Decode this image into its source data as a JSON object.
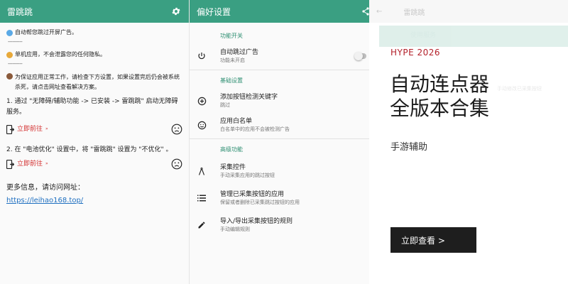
{
  "panel1": {
    "title": "雷跳跳",
    "notes": [
      {
        "text": "自动帮您跳过开屏广告。",
        "dot_color": "#5aa9e6"
      },
      {
        "text": "单机应用，不会泄露您的任何隐私。",
        "dot_color": "#e8a93a"
      },
      {
        "text": "为保证应用正常工作，请检查下方设置，如果设置完后仍会被系统杀死，请点击网址查看解决方案。",
        "dot_color": "#8a5a3b"
      }
    ],
    "dash": "----------",
    "steps": [
      {
        "text": "1. 通过 \"无障碍/辅助功能 -> 已安装 -> 雷跳跳\" 启动无障碍服务。",
        "link": "立即前往",
        "arrows": "»"
      },
      {
        "text": "2. 在 \"电池优化\" 设置中，将 \"雷跳跳\" 设置为 \"不优化\" 。",
        "link": "立即前往",
        "arrows": "»"
      }
    ],
    "more_info": "更多信息，请访问网址：",
    "url": "https://leihao168.top/"
  },
  "panel2": {
    "title": "偏好设置",
    "sections": [
      {
        "header": "功能开关",
        "items": [
          {
            "icon": "power-icon",
            "title": "自动跳过广告",
            "subtitle": "功能未开启",
            "toggle": false
          }
        ]
      },
      {
        "header": "基础设置",
        "items": [
          {
            "icon": "add-circle-icon",
            "title": "添加按钮检测关键字",
            "subtitle": "跳过"
          },
          {
            "icon": "smiley-icon",
            "title": "应用白名单",
            "subtitle": "白名单中的应用不会被检测广告"
          }
        ]
      },
      {
        "header": "高级功能",
        "items": [
          {
            "icon": "compass-icon",
            "title": "采集控件",
            "subtitle": "手动采集应用的跳过按钮"
          },
          {
            "icon": "list-icon",
            "title": "管理已采集按钮的应用",
            "subtitle": "保留或者删除已采集跳过按钮的应用"
          },
          {
            "icon": "edit-icon",
            "title": "导入/导出采集按钮的规则",
            "subtitle": "手动编辑规则"
          }
        ]
      }
    ]
  },
  "ad": {
    "bg_title": "雷跳跳",
    "bg_row": "使用服务",
    "bg_ghost": "手动修改已采集按钮",
    "kicker": "HYPE 2026",
    "headline": "自动连点器\n全版本合集",
    "sub": "手游辅助",
    "cta": "立即查看 >"
  }
}
